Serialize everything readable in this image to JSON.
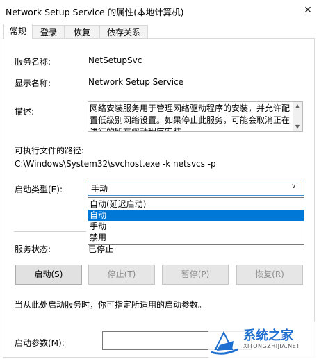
{
  "window": {
    "title": "Network Setup Service 的属性(本地计算机)",
    "close": "✕"
  },
  "tabs": [
    "常规",
    "登录",
    "恢复",
    "依存关系"
  ],
  "fields": {
    "service_name_label": "服务名称:",
    "service_name": "NetSetupSvc",
    "display_name_label": "显示名称:",
    "display_name": "Network Setup Service",
    "description_label": "描述:",
    "description_lines": [
      "网络安装服务用于管理网络驱动程序的安装，并允许配",
      "置低级别网络设置。如果停止此服务，可能会取消正在",
      "进行的所有驱动程序安装。"
    ],
    "exe_path_label": "可执行文件的路径:",
    "exe_path": "C:\\Windows\\System32\\svchost.exe -k netsvcs -p",
    "startup_type_label": "启动类型(E):",
    "startup_type_value": "手动",
    "startup_options": [
      "自动(延迟启动)",
      "自动",
      "手动",
      "禁用"
    ],
    "startup_selected_index": 1,
    "status_label": "服务状态:",
    "status_value": "已停止"
  },
  "buttons": {
    "start": "启动(S)",
    "stop": "停止(T)",
    "pause": "暂停(P)",
    "resume": "恢复(R)"
  },
  "hint": "当从此处启动服务时，你可指定所适用的启动参数。",
  "start_params_label": "启动参数(M):",
  "watermark": {
    "brand": "系统之家",
    "url": "XITONGZHIJIA.NET"
  },
  "colors": {
    "selection": "#0078d7",
    "focus_border": "#4a8fd6",
    "watermark_blue": "#1f6fd1"
  }
}
